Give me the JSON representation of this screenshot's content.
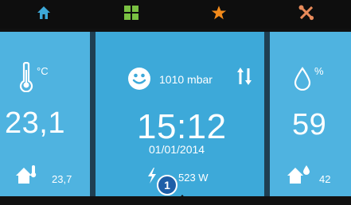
{
  "colors": {
    "panel": "#4fb3e0",
    "panel_center": "#3da9d9",
    "home_tab": "#3da9d9",
    "apps_tab": "#7ac142",
    "fav_tab": "#f28a1b",
    "tools_tab": "#e98b5a"
  },
  "tabs": [
    {
      "name": "home",
      "icon": "home-icon"
    },
    {
      "name": "apps",
      "icon": "grid-icon"
    },
    {
      "name": "favorites",
      "icon": "star-icon"
    },
    {
      "name": "tools",
      "icon": "tools-icon"
    }
  ],
  "left": {
    "unit": "°C",
    "value": "23,1",
    "indoor_value": "23,7"
  },
  "center": {
    "pressure": "1010 mbar",
    "time": "15:12",
    "date": "01/01/2014",
    "power": "523 W",
    "badge": "1"
  },
  "right": {
    "unit": "%",
    "value": "59",
    "indoor_value": "42"
  }
}
